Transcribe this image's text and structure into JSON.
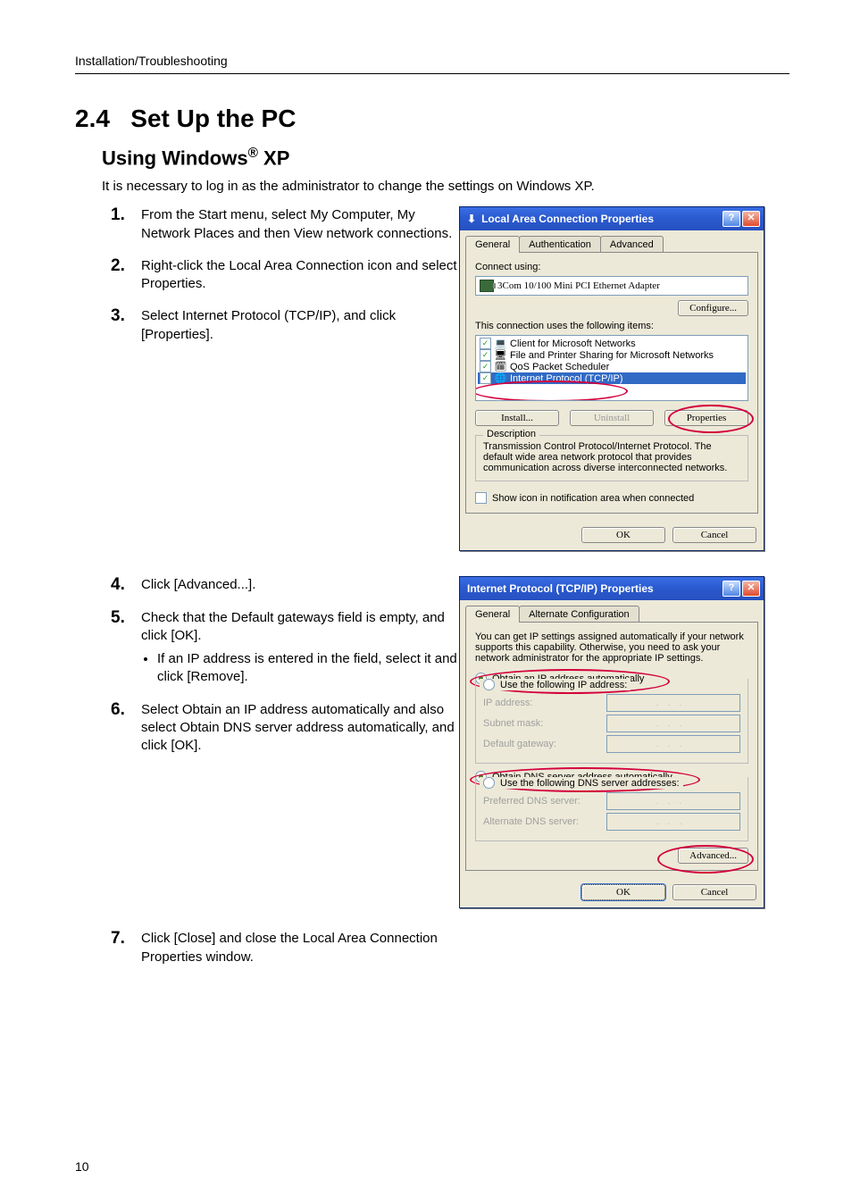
{
  "running_head": "Installation/Troubleshooting",
  "section": {
    "number": "2.4",
    "title": "Set Up the PC"
  },
  "subsection": {
    "prefix": "Using Windows",
    "reg": "®",
    "suffix": " XP"
  },
  "intro": "It is necessary to log in as the administrator to change the settings on Windows XP.",
  "steps": {
    "s1": "From the Start menu, select My Computer, My Network Places and then View network connections.",
    "s2": "Right-click the Local Area Connection icon and select Properties.",
    "s3": "Select Internet Protocol (TCP/IP), and click [Properties].",
    "s4": "Click [Advanced...].",
    "s5": "Check that the Default gateways field is empty, and click [OK].",
    "s5b": "If an IP address is entered in the field, select it and click [Remove].",
    "s6": "Select Obtain an IP address automatically and also select Obtain DNS server address automatically, and click [OK].",
    "s7": "Click [Close] and close the Local Area Connection Properties window."
  },
  "dlg1": {
    "title": "Local Area Connection Properties",
    "tab_general": "General",
    "tab_auth": "Authentication",
    "tab_adv": "Advanced",
    "connect_using": "Connect using:",
    "adapter": "3Com 10/100 Mini PCI Ethernet Adapter",
    "configure": "Configure...",
    "items_label": "This connection uses the following items:",
    "item1": "Client for Microsoft Networks",
    "item2": "File and Printer Sharing for Microsoft Networks",
    "item3": "QoS Packet Scheduler",
    "item4": "Internet Protocol (TCP/IP)",
    "install": "Install...",
    "uninstall": "Uninstall",
    "properties": "Properties",
    "description_label": "Description",
    "description": "Transmission Control Protocol/Internet Protocol. The default wide area network protocol that provides communication across diverse interconnected networks.",
    "show_icon": "Show icon in notification area when connected",
    "ok": "OK",
    "cancel": "Cancel"
  },
  "dlg2": {
    "title": "Internet Protocol (TCP/IP) Properties",
    "tab_general": "General",
    "tab_alt": "Alternate Configuration",
    "blurb": "You can get IP settings assigned automatically if your network supports this capability. Otherwise, you need to ask your network administrator for the appropriate IP settings.",
    "obtain_ip": "Obtain an IP address automatically",
    "use_ip": "Use the following IP address:",
    "ip_address": "IP address:",
    "subnet": "Subnet mask:",
    "gateway": "Default gateway:",
    "obtain_dns": "Obtain DNS server address automatically",
    "use_dns": "Use the following DNS server addresses:",
    "pref_dns": "Preferred DNS server:",
    "alt_dns": "Alternate DNS server:",
    "advanced": "Advanced...",
    "ok": "OK",
    "cancel": "Cancel"
  },
  "page_number": "10"
}
